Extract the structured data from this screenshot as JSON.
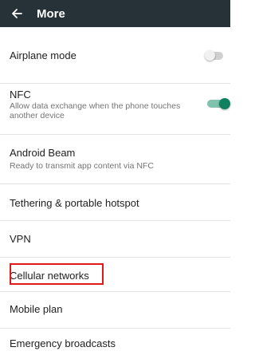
{
  "appbar": {
    "title": "More",
    "icon": "back-arrow-icon"
  },
  "settings": [
    {
      "id": "airplane",
      "label": "Airplane mode",
      "toggle": false
    },
    {
      "id": "nfc",
      "label": "NFC",
      "sub": "Allow data exchange when the phone touches another device",
      "toggle": true
    },
    {
      "id": "android-beam",
      "label": "Android Beam",
      "sub": "Ready to transmit app content via NFC"
    },
    {
      "id": "tethering",
      "label": "Tethering & portable hotspot"
    },
    {
      "id": "vpn",
      "label": "VPN"
    },
    {
      "id": "cellular",
      "label": "Cellular networks",
      "highlighted": true
    },
    {
      "id": "mobile-plan",
      "label": "Mobile plan"
    },
    {
      "id": "emergency",
      "label": "Emergency broadcasts"
    }
  ],
  "colors": {
    "appbar": "#273238",
    "highlight": "#e01818",
    "toggle_on": "#0f8060"
  }
}
